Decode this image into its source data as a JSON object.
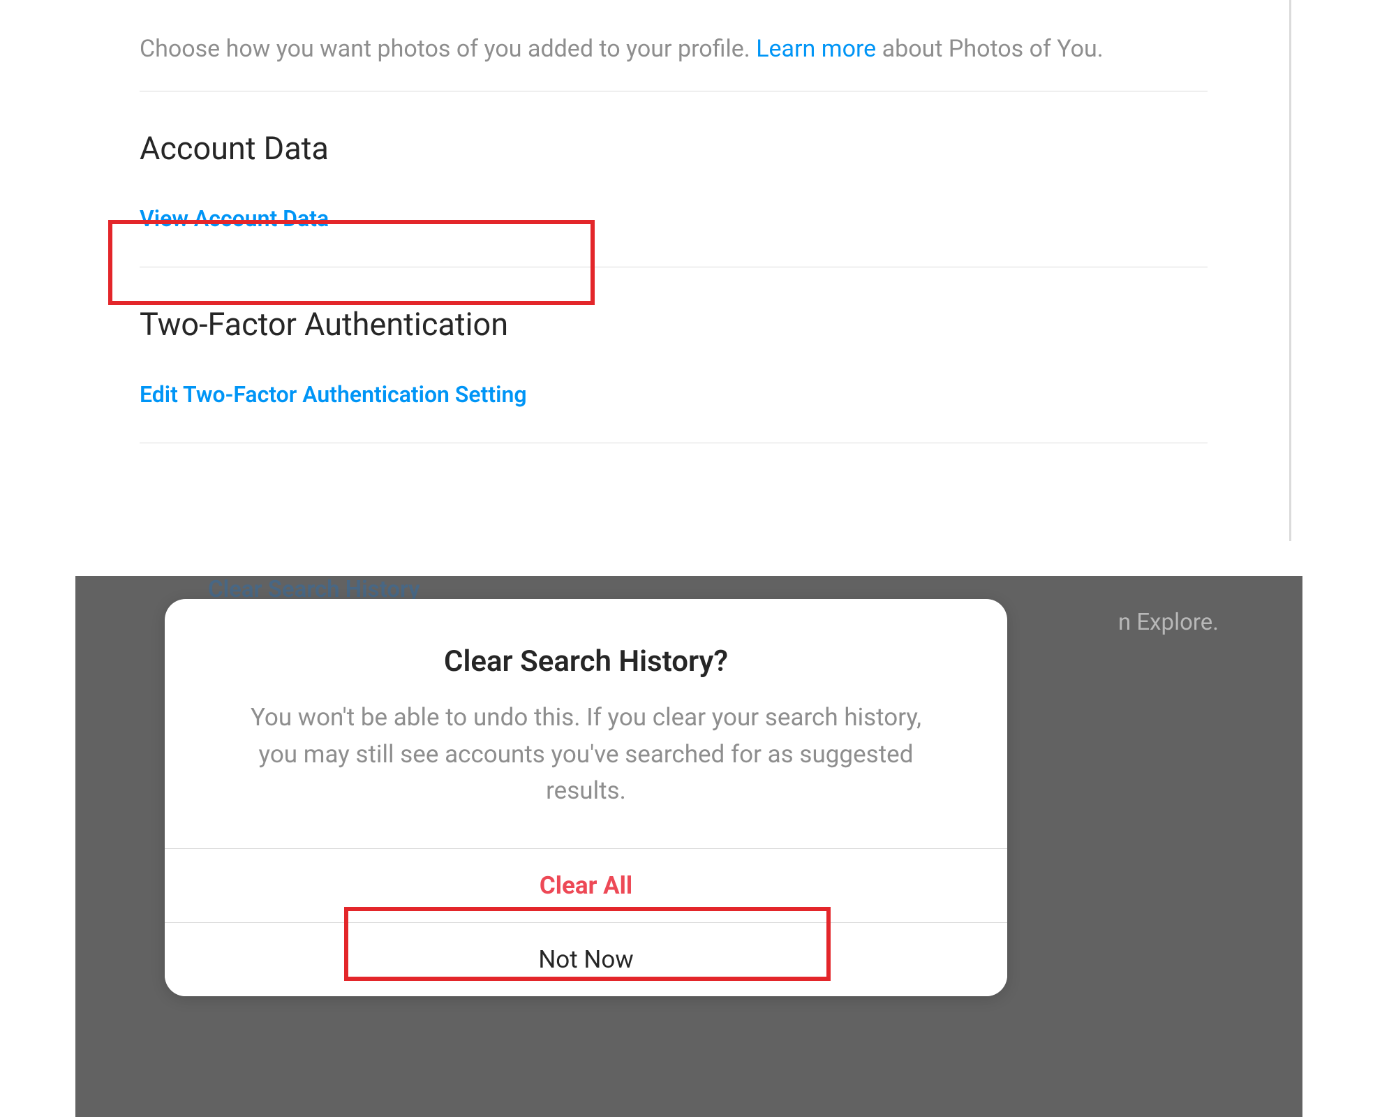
{
  "photos_section": {
    "description_prefix": "Choose how you want photos of you added to your profile. ",
    "learn_more_label": "Learn more",
    "description_suffix": " about Photos of You."
  },
  "account_data": {
    "heading": "Account Data",
    "link_label": "View Account Data"
  },
  "two_factor": {
    "heading": "Two-Factor Authentication",
    "link_label": "Edit Two-Factor Authentication Setting"
  },
  "background_fragments": {
    "clear_search_link": "Clear Search History",
    "explore_suffix": "n Explore."
  },
  "dialog": {
    "title": "Clear Search History?",
    "body": "You won't be able to undo this. If you clear your search history, you may still see accounts you've searched for as suggested results.",
    "clear_all_label": "Clear All",
    "not_now_label": "Not Now"
  }
}
